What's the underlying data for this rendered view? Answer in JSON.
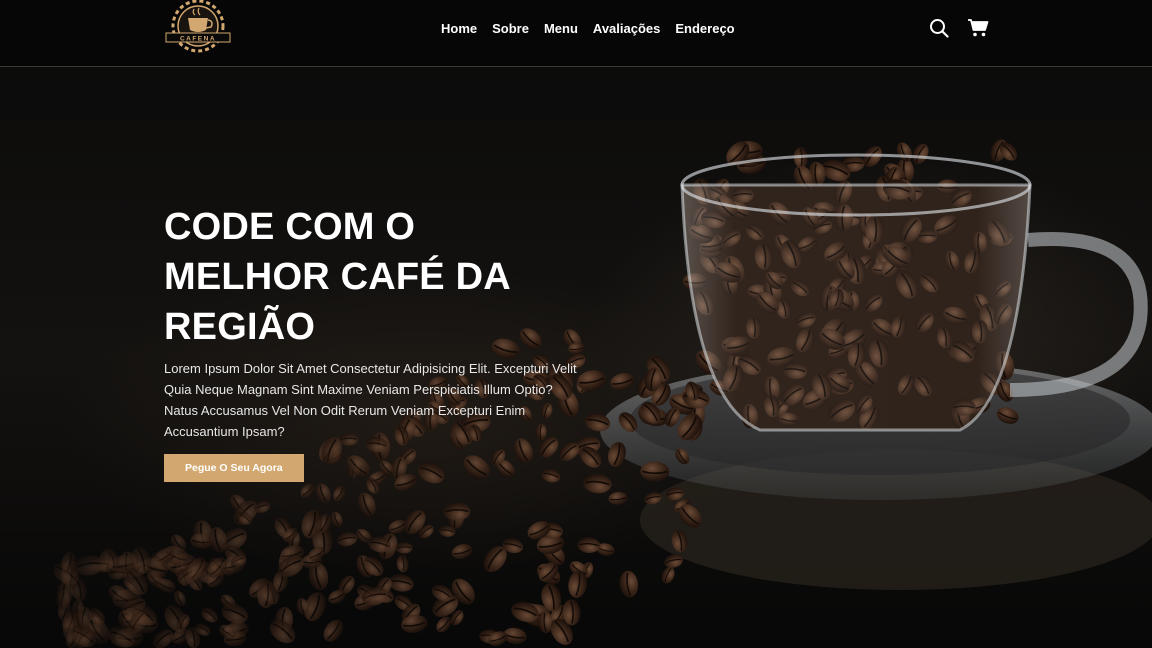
{
  "brand": {
    "logo_text": "CAFENA",
    "accent_color": "#d3a870",
    "logo_icon": "coffee-cup-gear-icon"
  },
  "nav": {
    "items": [
      {
        "label": "Home"
      },
      {
        "label": "Sobre"
      },
      {
        "label": "Menu"
      },
      {
        "label": "Avaliações"
      },
      {
        "label": "Endereço"
      }
    ],
    "icons": [
      "search-icon",
      "cart-icon"
    ]
  },
  "hero": {
    "title_lines": [
      "CODE COM O",
      "MELHOR CAFÉ DA",
      "REGIÃO"
    ],
    "text": "Lorem Ipsum Dolor Sit Amet Consectetur Adipisicing Elit. Excepturi Velit Quia Neque Magnam Sint Maxime Veniam Perspiciatis Illum Optio? Natus Accusamus Vel Non Odit Rerum Veniam Excepturi Enim Accusantium Ipsam?",
    "cta_label": "Pegue O Seu Agora",
    "background_image": "coffee-beans-glass-cup-image"
  }
}
